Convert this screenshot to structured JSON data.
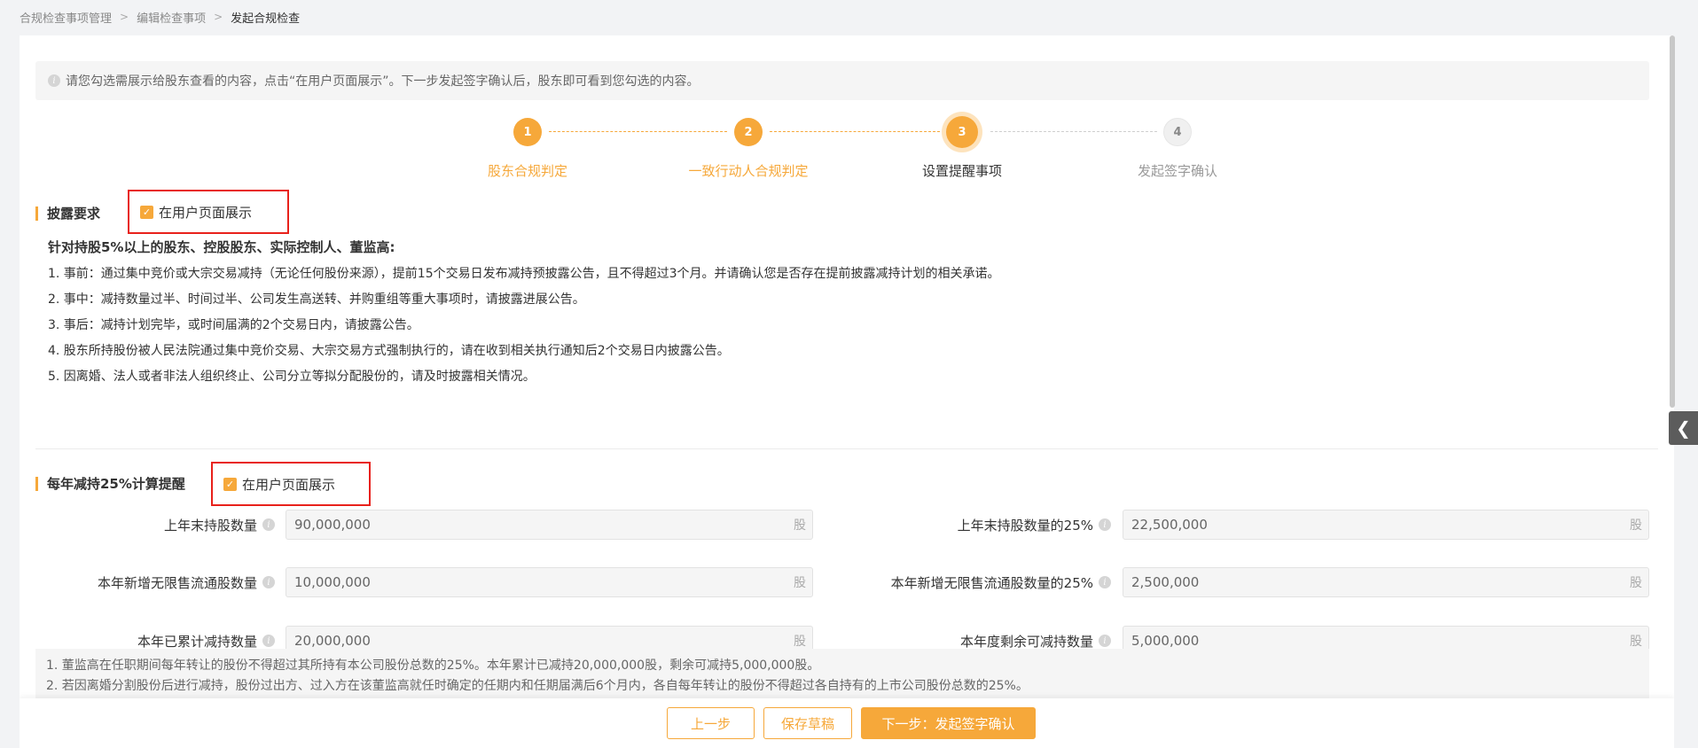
{
  "breadcrumb": {
    "items": [
      "合规检查事项管理",
      "编辑检查事项"
    ],
    "current": "发起合规检查"
  },
  "tip": {
    "text": "请您勾选需展示给股东查看的内容，点击“在用户页面展示”。下一步发起签字确认后，股东即可看到您勾选的内容。"
  },
  "steps": [
    {
      "number": "1",
      "label": "股东合规判定",
      "status": "done"
    },
    {
      "number": "2",
      "label": "一致行动人合规判定",
      "status": "done"
    },
    {
      "number": "3",
      "label": "设置提醒事项",
      "status": "active"
    },
    {
      "number": "4",
      "label": "发起签字确认",
      "status": "pending"
    }
  ],
  "disclosure": {
    "title": "披露要求",
    "show_label": "在用户页面展示",
    "checked": true,
    "heading": "针对持股5%以上的股东、控股股东、实际控制人、董监高:",
    "items": [
      "1. 事前：通过集中竞价或大宗交易减持（无论任何股份来源），提前15个交易日发布减持预披露公告，且不得超过3个月。并请确认您是否存在提前披露减持计划的相关承诺。",
      "2. 事中：减持数量过半、时间过半、公司发生高送转、并购重组等重大事项时，请披露进展公告。",
      "3. 事后：减持计划完毕，或时间届满的2个交易日内，请披露公告。",
      "4. 股东所持股份被人民法院通过集中竞价交易、大宗交易方式强制执行的，请在收到相关执行通知后2个交易日内披露公告。",
      "5. 因离婚、法人或者非法人组织终止、公司分立等拟分配股份的，请及时披露相关情况。"
    ]
  },
  "annual": {
    "title": "每年减持25%计算提醒",
    "show_label": "在用户页面展示",
    "checked": true,
    "unit": "股",
    "fields_left": [
      {
        "label": "上年末持股数量",
        "value": "90,000,000"
      },
      {
        "label": "本年新增无限售流通股数量",
        "value": "10,000,000"
      },
      {
        "label": "本年已累计减持数量",
        "value": "20,000,000"
      }
    ],
    "fields_right": [
      {
        "label": "上年末持股数量的25%",
        "value": "22,500,000"
      },
      {
        "label": "本年新增无限售流通股数量的25%",
        "value": "2,500,000"
      },
      {
        "label": "本年度剩余可减持数量",
        "value": "5,000,000"
      }
    ],
    "notes": [
      "1. 董监高在任职期间每年转让的股份不得超过其所持有本公司股份总数的25%。本年累计已减持20,000,000股，剩余可减持5,000,000股。",
      "2. 若因离婚分割股份后进行减持，股份过出方、过入方在该董监高就任时确定的任期内和任期届满后6个月内，各自每年转让的股份不得超过各自持有的上市公司股份总数的25%。"
    ]
  },
  "footer": {
    "prev": "上一步",
    "save": "保存草稿",
    "next": "下一步：发起签字确认"
  },
  "icons": {
    "info": "info-icon",
    "check": "check-icon",
    "collapse": "chevron-left-icon",
    "separator": "chevron-right-icon"
  },
  "colors": {
    "accent": "#f6a83a",
    "highlight_box": "#e8211b"
  }
}
